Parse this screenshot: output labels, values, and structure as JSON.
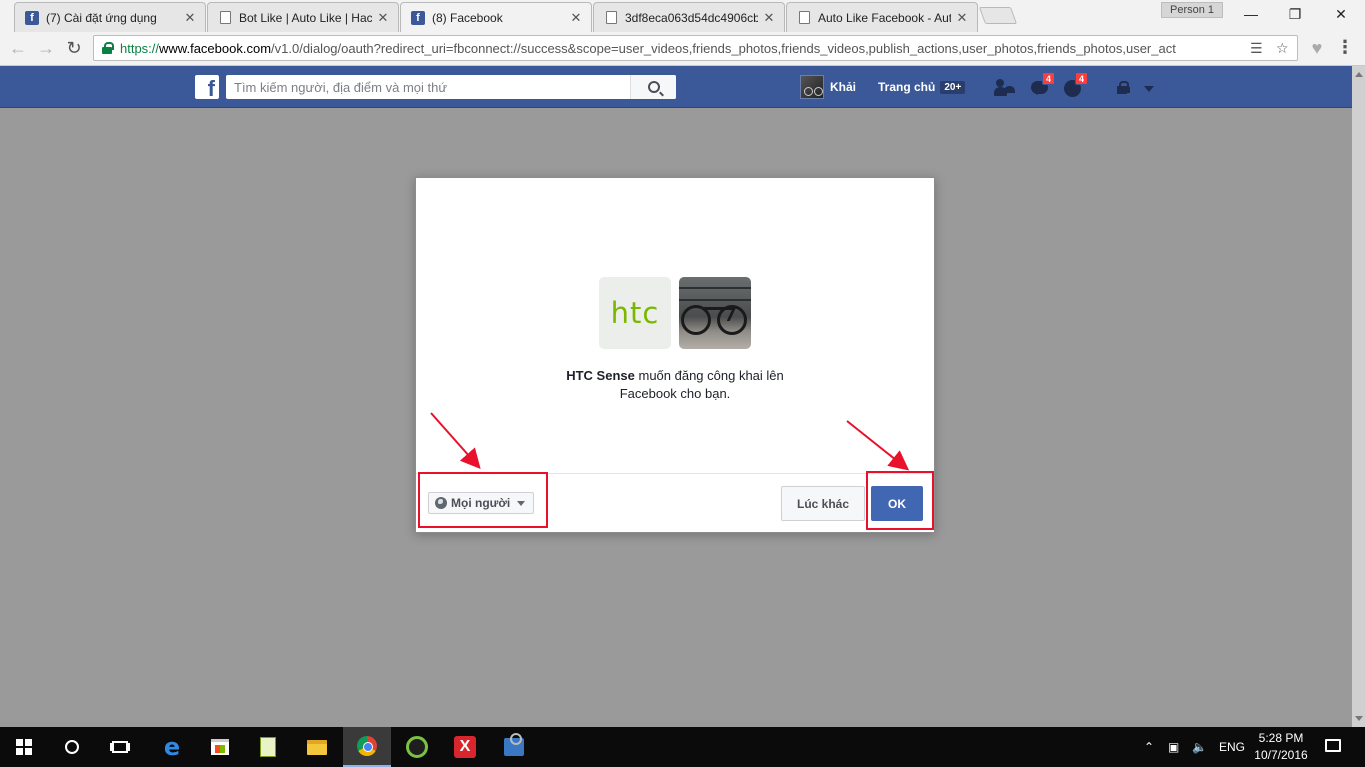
{
  "browser": {
    "tabs": [
      {
        "title": "(7) Cài đặt ứng dụng",
        "icon": "facebook-favicon-icon"
      },
      {
        "title": "Bot Like | Auto Like | Hac",
        "icon": "document-favicon-icon"
      },
      {
        "title": "(8) Facebook",
        "icon": "facebook-favicon-icon",
        "active": true
      },
      {
        "title": "3df8eca063d54dc4906cb",
        "icon": "document-favicon-icon"
      },
      {
        "title": "Auto Like Facebook - Aut",
        "icon": "document-favicon-icon"
      }
    ],
    "profile": "Person 1",
    "url": {
      "scheme": "https://",
      "host": "www.facebook.com",
      "path": "/v1.0/dialog/oauth?redirect_uri=fbconnect://success&scope=user_videos,friends_photos,friends_videos,publish_actions,user_photos,friends_photos,user_act"
    }
  },
  "facebook_bar": {
    "logo": "f",
    "search_placeholder": "Tìm kiếm người, địa điểm và mọi thứ",
    "user_name": "Khải",
    "home_label": "Trang chủ",
    "home_count": "20+",
    "messages_badge": "4",
    "notifications_badge": "4"
  },
  "dialog": {
    "app_logo_text": "htc",
    "app_name": "HTC Sense",
    "message_rest": "muốn đăng công khai lên",
    "message_line2": "Facebook cho bạn.",
    "audience_label": "Mọi người",
    "later_button": "Lúc khác",
    "ok_button": "OK"
  },
  "annotation_color": "#e8102a",
  "taskbar": {
    "language": "ENG",
    "time": "5:28 PM",
    "date": "10/7/2016",
    "pinned_icons": [
      "windows-start-icon",
      "cortana-icon",
      "task-view-icon",
      "edge-icon",
      "store-icon",
      "notepad-icon",
      "file-explorer-icon",
      "chrome-icon",
      "green-app-icon",
      "red-app-icon",
      "tool-app-icon"
    ]
  }
}
